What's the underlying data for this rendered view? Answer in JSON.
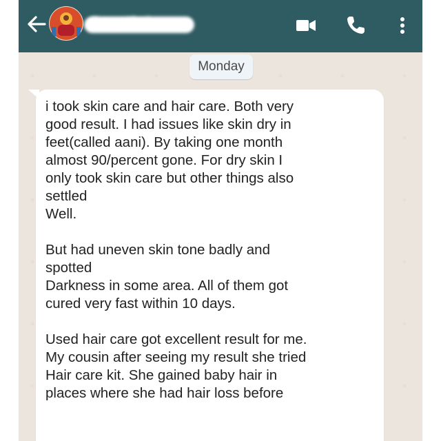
{
  "header": {
    "contact_name": "Gayathri",
    "colors": {
      "bar": "#2f5c62",
      "icons": "#ffffff"
    },
    "icons": {
      "back": "arrow-left-icon",
      "video": "video-camera-icon",
      "call": "phone-icon",
      "menu": "kebab-menu-icon"
    }
  },
  "chat": {
    "date_label": "Monday",
    "background_color": "#ece5dd",
    "message": {
      "lines": [
        "i took skin care and hair care. Both  very",
        "good result. I had issues like skin dry in",
        "feet(called aani). By taking one month",
        "almost 90/percent gone. For dry skin I",
        "only took skin care but other things also",
        "settled",
        "Well.",
        "",
        "But had uneven skin tone badly and",
        "spotted",
        "Darkness in some area. All of them got",
        "cured very fast within 10 days.",
        "",
        "Used hair care got excellent result for me.",
        "My cousin after seeing my result she tried",
        "Hair care kit. She gained baby hair in",
        "places where she had hair loss before"
      ]
    }
  }
}
